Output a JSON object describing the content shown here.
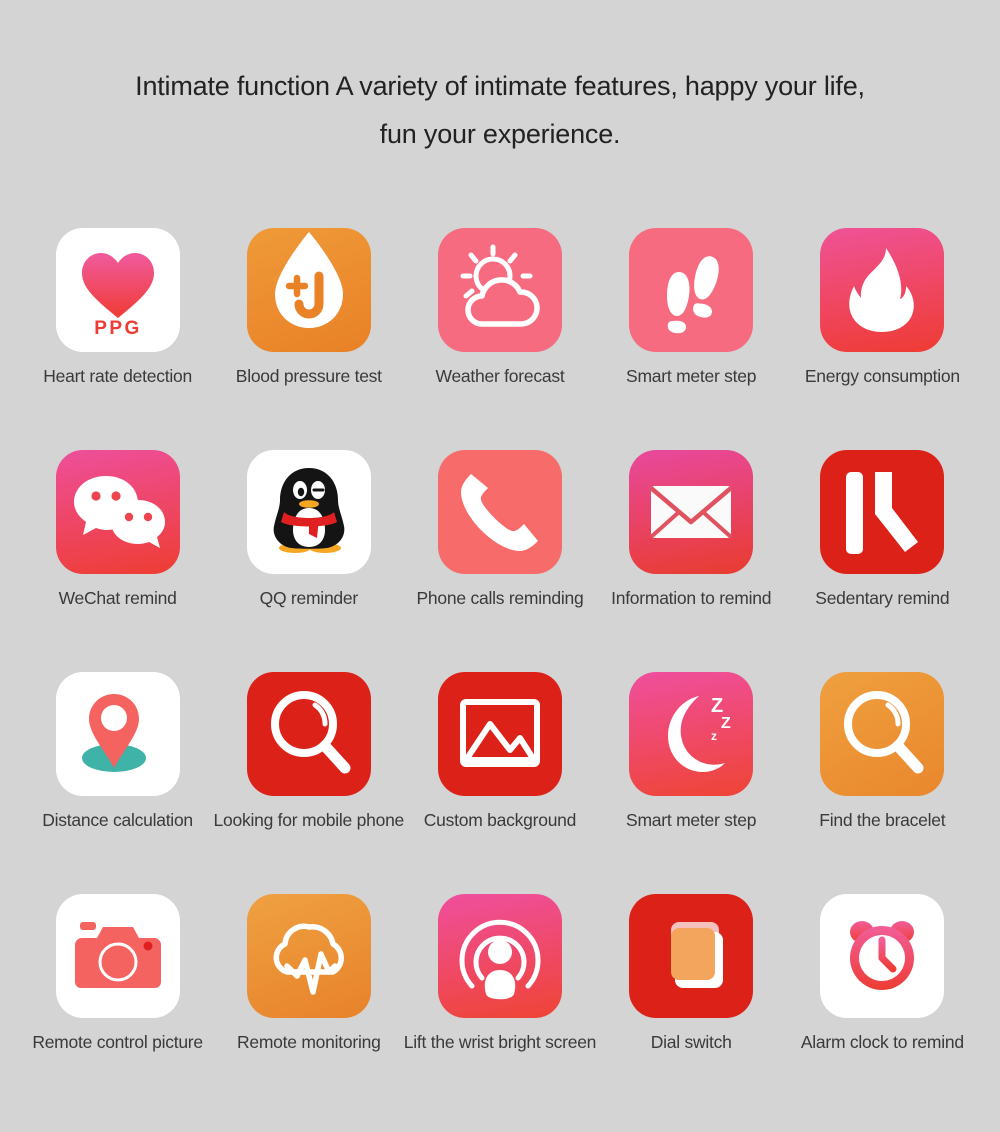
{
  "heading": {
    "line1": "Intimate function A variety of intimate features, happy your life,",
    "line2": "fun your experience."
  },
  "colors": {
    "page_background": "#d4d4d4",
    "heading_text": "#222222",
    "label_text": "#3a3a3a",
    "pink": "#f4608c",
    "red": "#ef3a33",
    "deep_red": "#d81e16",
    "coral": "#f76b6b",
    "orange": "#eb8a2e",
    "orange_light": "#f0a043",
    "teal": "#3fb3a8",
    "white": "#ffffff"
  },
  "rows": [
    {
      "items": [
        {
          "label": "Heart rate detection",
          "icon": "heart-ppg-icon",
          "tile": "white",
          "badge_text": "PPG"
        },
        {
          "label": "Blood pressure test",
          "icon": "blood-drop-icon",
          "tile": "orange"
        },
        {
          "label": "Weather forecast",
          "icon": "sun-cloud-icon",
          "tile": "pink"
        },
        {
          "label": "Smart meter step",
          "icon": "footprints-icon",
          "tile": "pink"
        },
        {
          "label": "Energy consumption",
          "icon": "flame-icon",
          "tile": "pink-red"
        }
      ]
    },
    {
      "items": [
        {
          "label": "WeChat remind",
          "icon": "wechat-bubbles-icon",
          "tile": "pink-red"
        },
        {
          "label": "QQ reminder",
          "icon": "qq-penguin-icon",
          "tile": "white"
        },
        {
          "label": "Phone calls reminding",
          "icon": "phone-handset-icon",
          "tile": "coral"
        },
        {
          "label": "Information to remind",
          "icon": "envelope-icon",
          "tile": "pink-red"
        },
        {
          "label": "Sedentary remind",
          "icon": "sedentary-icon",
          "tile": "deep-red"
        }
      ]
    },
    {
      "items": [
        {
          "label": "Distance calculation",
          "icon": "map-pin-icon",
          "tile": "white"
        },
        {
          "label": "Looking for mobile phone",
          "icon": "magnifier-icon",
          "tile": "deep-red"
        },
        {
          "label": "Custom background",
          "icon": "picture-icon",
          "tile": "deep-red"
        },
        {
          "label": "Smart meter step",
          "icon": "moon-sleep-icon",
          "tile": "pink-red"
        },
        {
          "label": "Find the bracelet",
          "icon": "magnifier-orange-icon",
          "tile": "orange"
        }
      ]
    },
    {
      "items": [
        {
          "label": "Remote control picture",
          "icon": "camera-icon",
          "tile": "white"
        },
        {
          "label": "Remote monitoring",
          "icon": "cloud-wave-icon",
          "tile": "orange"
        },
        {
          "label": "Lift the wrist bright screen",
          "icon": "broadcast-icon",
          "tile": "pink-red"
        },
        {
          "label": "Dial switch",
          "icon": "dial-squares-icon",
          "tile": "deep-red"
        },
        {
          "label": "Alarm clock to remind",
          "icon": "alarm-clock-icon",
          "tile": "white"
        }
      ]
    }
  ]
}
